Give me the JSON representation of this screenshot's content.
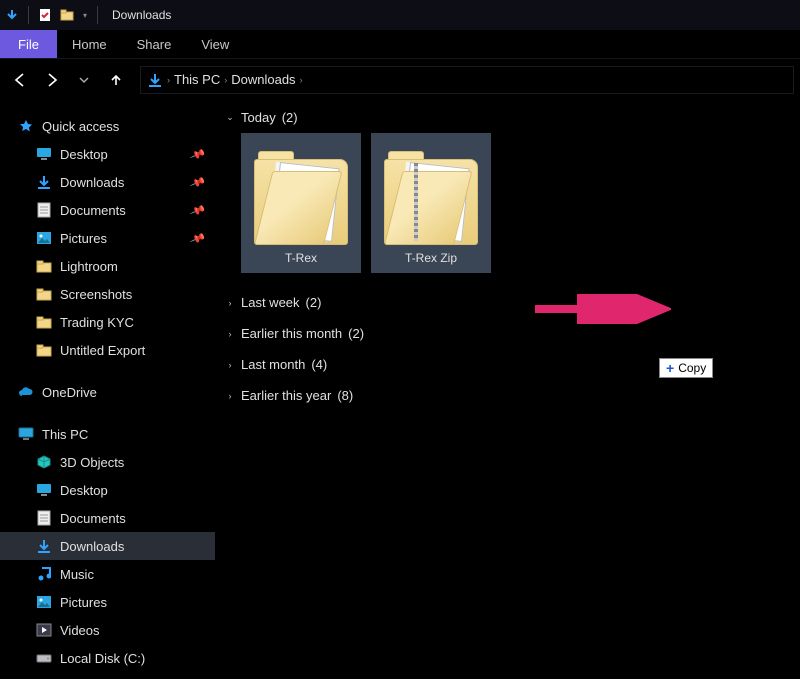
{
  "window": {
    "title": "Downloads"
  },
  "ribbon": {
    "file": "File",
    "tabs": [
      "Home",
      "Share",
      "View"
    ]
  },
  "breadcrumb": {
    "root": "This PC",
    "current": "Downloads"
  },
  "sidebar": {
    "quick_access_label": "Quick access",
    "quick_access": [
      {
        "label": "Desktop",
        "icon": "desktop",
        "pinned": true
      },
      {
        "label": "Downloads",
        "icon": "downloads",
        "pinned": true
      },
      {
        "label": "Documents",
        "icon": "documents",
        "pinned": true
      },
      {
        "label": "Pictures",
        "icon": "pictures",
        "pinned": true
      },
      {
        "label": "Lightroom",
        "icon": "folder",
        "pinned": false
      },
      {
        "label": "Screenshots",
        "icon": "folder",
        "pinned": false
      },
      {
        "label": "Trading KYC",
        "icon": "folder",
        "pinned": false
      },
      {
        "label": "Untitled Export",
        "icon": "folder",
        "pinned": false
      }
    ],
    "onedrive_label": "OneDrive",
    "thispc_label": "This PC",
    "thispc": [
      {
        "label": "3D Objects",
        "icon": "objects3d"
      },
      {
        "label": "Desktop",
        "icon": "desktop"
      },
      {
        "label": "Documents",
        "icon": "documents"
      },
      {
        "label": "Downloads",
        "icon": "downloads",
        "selected": true
      },
      {
        "label": "Music",
        "icon": "music"
      },
      {
        "label": "Pictures",
        "icon": "pictures"
      },
      {
        "label": "Videos",
        "icon": "videos"
      },
      {
        "label": "Local Disk (C:)",
        "icon": "drive"
      }
    ]
  },
  "content": {
    "groups": [
      {
        "label": "Today",
        "count": 2,
        "expanded": true,
        "items": [
          {
            "label": "T-Rex",
            "type": "folder",
            "selected": true
          },
          {
            "label": "T-Rex Zip",
            "type": "zip",
            "selected": true
          }
        ]
      },
      {
        "label": "Last week",
        "count": 2,
        "expanded": false
      },
      {
        "label": "Earlier this month",
        "count": 2,
        "expanded": false
      },
      {
        "label": "Last month",
        "count": 4,
        "expanded": false
      },
      {
        "label": "Earlier this year",
        "count": 8,
        "expanded": false
      }
    ]
  },
  "drag": {
    "tooltip_label": "Copy"
  }
}
